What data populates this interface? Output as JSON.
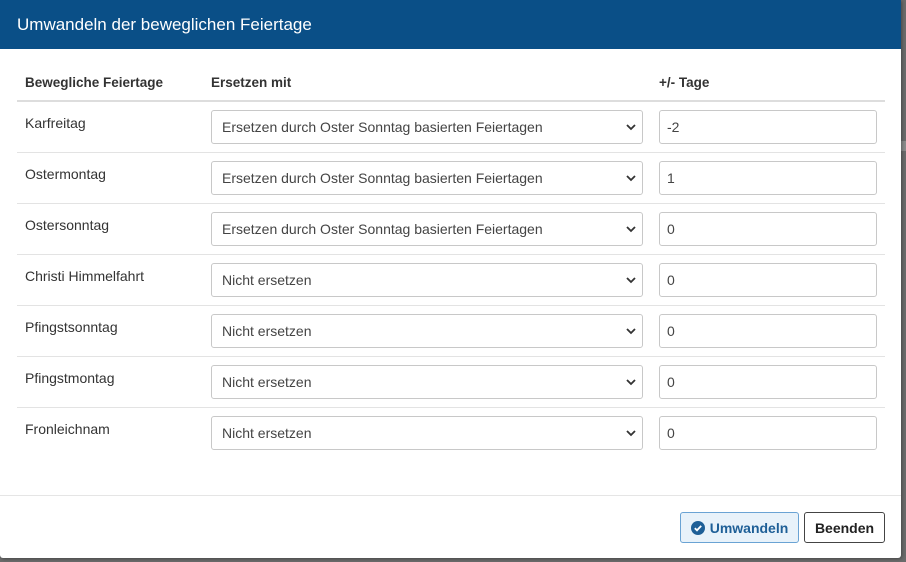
{
  "dialog": {
    "title": "Umwandeln der beweglichen Feiertage"
  },
  "table": {
    "headers": {
      "holiday": "Bewegliche Feiertage",
      "replace": "Ersetzen mit",
      "days": "+/- Tage"
    },
    "rows": [
      {
        "holiday": "Karfreitag",
        "replace": "Ersetzen durch Oster Sonntag basierten Feiertagen",
        "days": "-2"
      },
      {
        "holiday": "Ostermontag",
        "replace": "Ersetzen durch Oster Sonntag basierten Feiertagen",
        "days": "1"
      },
      {
        "holiday": "Ostersonntag",
        "replace": "Ersetzen durch Oster Sonntag basierten Feiertagen",
        "days": "0"
      },
      {
        "holiday": "Christi Himmelfahrt",
        "replace": "Nicht ersetzen",
        "days": "0"
      },
      {
        "holiday": "Pfingstsonntag",
        "replace": "Nicht ersetzen",
        "days": "0"
      },
      {
        "holiday": "Pfingstmontag",
        "replace": "Nicht ersetzen",
        "days": "0"
      },
      {
        "holiday": "Fronleichnam",
        "replace": "Nicht ersetzen",
        "days": "0"
      }
    ]
  },
  "footer": {
    "convert_label": "Umwandeln",
    "convert_icon": "check-circle-icon",
    "close_label": "Beenden"
  },
  "colors": {
    "header_bg": "#0a4f87",
    "primary_text": "#1e5f97"
  }
}
